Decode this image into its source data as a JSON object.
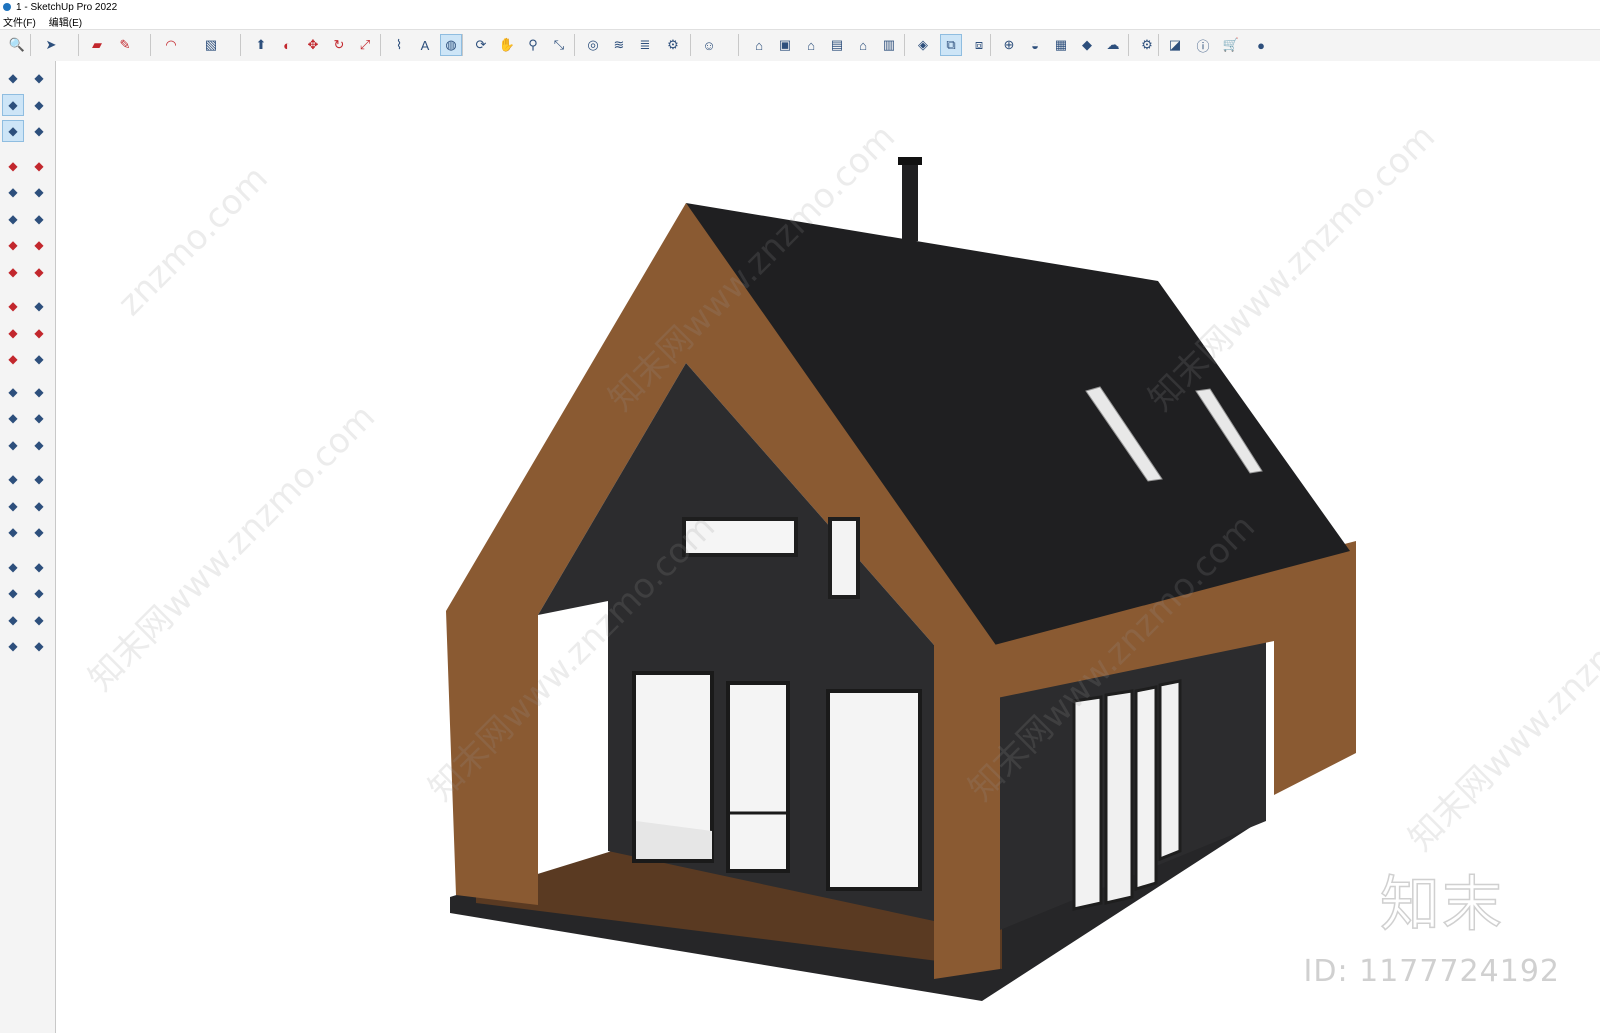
{
  "window": {
    "title": "1 - SketchUp Pro 2022"
  },
  "menu": {
    "items": [
      "文件(F)",
      "编辑(E)"
    ]
  },
  "toolbar": {
    "tools": [
      {
        "name": "zoom-extents-icon",
        "glyph": "🔍"
      },
      {
        "name": "select-icon",
        "glyph": "➤"
      },
      {
        "name": "eraser-icon",
        "glyph": "▰"
      },
      {
        "name": "line-icon",
        "glyph": "✎"
      },
      {
        "name": "arc-icon",
        "glyph": "◠"
      },
      {
        "name": "rectangle-icon",
        "glyph": "▧"
      },
      {
        "name": "push-pull-icon",
        "glyph": "⬆"
      },
      {
        "name": "follow-me-icon",
        "glyph": "◐"
      },
      {
        "name": "move-icon",
        "glyph": "✥"
      },
      {
        "name": "rotate-icon",
        "glyph": "↻"
      },
      {
        "name": "scale-icon",
        "glyph": "⤢"
      },
      {
        "name": "tape-measure-icon",
        "glyph": "⌇"
      },
      {
        "name": "text-icon",
        "glyph": "A"
      },
      {
        "name": "paint-bucket-icon",
        "glyph": "◍"
      },
      {
        "name": "orbit-icon",
        "glyph": "⟳"
      },
      {
        "name": "pan-icon",
        "glyph": "✋"
      },
      {
        "name": "zoom-icon",
        "glyph": "⚲"
      },
      {
        "name": "zoom-window-icon",
        "glyph": "⤡"
      },
      {
        "name": "outer-shell-icon",
        "glyph": "◎"
      },
      {
        "name": "tag-icon",
        "glyph": "≋"
      },
      {
        "name": "layers-icon",
        "glyph": "≣"
      },
      {
        "name": "section-icon",
        "glyph": "⚙"
      },
      {
        "name": "user-icon",
        "glyph": "☺"
      },
      {
        "name": "iso-view-icon",
        "glyph": "⌂"
      },
      {
        "name": "top-view-icon",
        "glyph": "▣"
      },
      {
        "name": "front-view-icon",
        "glyph": "⌂"
      },
      {
        "name": "right-view-icon",
        "glyph": "▤"
      },
      {
        "name": "back-view-icon",
        "glyph": "⌂"
      },
      {
        "name": "left-view-icon",
        "glyph": "▥"
      },
      {
        "name": "component-icon",
        "glyph": "◈"
      },
      {
        "name": "outliner-icon",
        "glyph": "⧉"
      },
      {
        "name": "scenes-icon",
        "glyph": "⧈"
      },
      {
        "name": "add-location-icon",
        "glyph": "⊕"
      },
      {
        "name": "shadow-icon",
        "glyph": "◒"
      },
      {
        "name": "styles-icon",
        "glyph": "▦"
      },
      {
        "name": "materials-icon",
        "glyph": "◆"
      },
      {
        "name": "cloud-icon",
        "glyph": "☁"
      },
      {
        "name": "extensions-icon",
        "glyph": "⚙"
      },
      {
        "name": "warehouse-icon",
        "glyph": "◪"
      },
      {
        "name": "info-icon",
        "glyph": "ⓘ"
      },
      {
        "name": "cart-icon",
        "glyph": "🛒"
      },
      {
        "name": "account-icon",
        "glyph": "●"
      }
    ]
  },
  "sidebar": {
    "tools": [
      "select-icon",
      "orbit-icon",
      "paint-bucket-icon",
      "eraser-icon",
      "component-icon",
      "tape-icon",
      "line-icon",
      "freehand-icon",
      "rectangle-icon",
      "rotated-rect-icon",
      "circle-icon",
      "polygon-icon",
      "arc-icon",
      "2pt-arc-icon",
      "pie-icon",
      "3pt-arc-icon",
      "move-icon",
      "push-pull-icon",
      "rotate-icon",
      "follow-me-icon",
      "scale-icon",
      "offset-icon",
      "tape-measure-icon",
      "dimension-icon",
      "protractor-icon",
      "text-icon",
      "axes-icon",
      "3d-text-icon",
      "orbit2-icon",
      "pan-icon",
      "zoom-icon",
      "zoom-window-icon",
      "zoom-extents-icon",
      "previous-view-icon",
      "position-camera-icon",
      "look-around-icon",
      "walk-icon",
      "section-plane-icon",
      "shell-icon",
      "tag-icon",
      "layers-icon",
      "section-display-icon"
    ]
  },
  "watermarks": [
    "znzmo.com",
    "知末网www.znzmo.com"
  ],
  "brand": {
    "logo": "知末",
    "id": "ID: 1177724192"
  },
  "colors": {
    "roof": "#1f1f21",
    "wood": "#8a5a32",
    "wall": "#2c2c2e",
    "glass": "#f4f4f4",
    "deck": "#5a3a22",
    "toolbar": "#f4f4f4",
    "accent": "#cde5f7"
  }
}
